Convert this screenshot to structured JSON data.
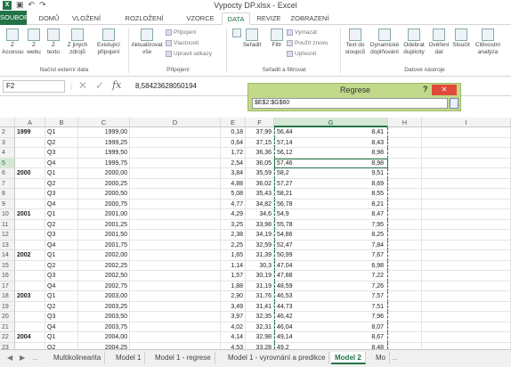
{
  "window": {
    "title": "Vypocty DP.xlsx - Excel",
    "app_icon": "X"
  },
  "ribbon_tabs": [
    {
      "label": "SOUBOR",
      "name": "tab-file"
    },
    {
      "label": "DOMŮ",
      "name": "tab-home"
    },
    {
      "label": "VLOŽENÍ",
      "name": "tab-insert"
    },
    {
      "label": "ROZLOŽENÍ STRÁNKY",
      "name": "tab-page-layout"
    },
    {
      "label": "VZORCE",
      "name": "tab-formulas"
    },
    {
      "label": "DATA",
      "name": "tab-data"
    },
    {
      "label": "REVIZE",
      "name": "tab-review"
    },
    {
      "label": "ZOBRAZENÍ",
      "name": "tab-view"
    }
  ],
  "ribbon": {
    "get_external": {
      "btn_access": "Z\nAccessu",
      "btn_web": "Z\nwebu",
      "btn_text": "Z\ntextu",
      "btn_other": "Z jiných\nzdrojů",
      "btn_existing": "Existující\npřipojení",
      "group_label": "Načíst externí data"
    },
    "connections": {
      "refresh_all": "Aktualizovat\nvše",
      "connections": "Připojení",
      "properties": "Vlastnosti",
      "edit_links": "Upravit odkazy",
      "group_label": "Připojení"
    },
    "sort_filter": {
      "sort": "Seřadit",
      "filter": "Filtr",
      "clear": "Vymazat",
      "reapply": "Použít znovu",
      "advanced": "Upřesnit",
      "group_label": "Seřadit a filtrovat"
    },
    "data_tools": {
      "text_to_columns": "Text do\nsloupců",
      "flash_fill": "Dynamické\ndoplňování",
      "remove_dup": "Odebrat\nduplicity",
      "validation": "Ověření\ndat",
      "consolidate": "Sloučit",
      "what_if": "Citlivostní\nanalýza",
      "group_label": "Datové nástroje"
    }
  },
  "formula_bar": {
    "name_box": "F2",
    "value": "8,58423628050194"
  },
  "dialog": {
    "title": "Regrese",
    "help": "?",
    "close": "✕",
    "input_value": "$E$2:$G$60"
  },
  "columns": [
    "A",
    "B",
    "C",
    "D",
    "E",
    "F",
    "G",
    "H",
    "I"
  ],
  "rows": [
    {
      "num": "2",
      "A": "1999",
      "B": "Q1",
      "C": "1999,00",
      "E": "0,18",
      "F": "37,99",
      "Fb": "56,44",
      "G": "8,41"
    },
    {
      "num": "3",
      "A": "",
      "B": "Q2",
      "C": "1999,25",
      "E": "0,64",
      "F": "37,15",
      "Fb": "57,14",
      "G": "8,43"
    },
    {
      "num": "4",
      "A": "",
      "B": "Q3",
      "C": "1999,50",
      "E": "1,72",
      "F": "36,36",
      "Fb": "56,12",
      "G": "8,98"
    },
    {
      "num": "5",
      "A": "",
      "B": "Q4",
      "C": "1999,75",
      "E": "2,54",
      "F": "36,05",
      "Fb": "57,46",
      "G": "8,98"
    },
    {
      "num": "6",
      "A": "2000",
      "B": "Q1",
      "C": "2000,00",
      "E": "3,84",
      "F": "35,59",
      "Fb": "58,2",
      "G": "9,51"
    },
    {
      "num": "7",
      "A": "",
      "B": "Q2",
      "C": "2000,25",
      "E": "4,88",
      "F": "36,02",
      "Fb": "57,27",
      "G": "8,69"
    },
    {
      "num": "8",
      "A": "",
      "B": "Q3",
      "C": "2000,50",
      "E": "5,08",
      "F": "35,43",
      "Fb": "58,21",
      "G": "8,55"
    },
    {
      "num": "9",
      "A": "",
      "B": "Q4",
      "C": "2000,75",
      "E": "4,77",
      "F": "34,82",
      "Fb": "56,78",
      "G": "8,21"
    },
    {
      "num": "10",
      "A": "2001",
      "B": "Q1",
      "C": "2001,00",
      "E": "4,29",
      "F": "34,6",
      "Fb": "54,9",
      "G": "8,47"
    },
    {
      "num": "11",
      "A": "",
      "B": "Q2",
      "C": "2001,25",
      "E": "3,25",
      "F": "33,98",
      "Fb": "55,78",
      "G": "7,95"
    },
    {
      "num": "12",
      "A": "",
      "B": "Q3",
      "C": "2001,50",
      "E": "2,38",
      "F": "34,19",
      "Fb": "54,86",
      "G": "8,25"
    },
    {
      "num": "13",
      "A": "",
      "B": "Q4",
      "C": "2001,75",
      "E": "2,25",
      "F": "32,59",
      "Fb": "52,47",
      "G": "7,84"
    },
    {
      "num": "14",
      "A": "2002",
      "B": "Q1",
      "C": "2002,00",
      "E": "1,65",
      "F": "31,39",
      "Fb": "50,99",
      "G": "7,67"
    },
    {
      "num": "15",
      "A": "",
      "B": "Q2",
      "C": "2002,25",
      "E": "1,14",
      "F": "30,3",
      "Fb": "47,04",
      "G": "6,98"
    },
    {
      "num": "16",
      "A": "",
      "B": "Q3",
      "C": "2002,50",
      "E": "1,57",
      "F": "30,19",
      "Fb": "47,88",
      "G": "7,22"
    },
    {
      "num": "17",
      "A": "",
      "B": "Q4",
      "C": "2002,75",
      "E": "1,88",
      "F": "31,19",
      "Fb": "48,59",
      "G": "7,26"
    },
    {
      "num": "18",
      "A": "2003",
      "B": "Q1",
      "C": "2003,00",
      "E": "2,90",
      "F": "31,76",
      "Fb": "46,53",
      "G": "7,57"
    },
    {
      "num": "19",
      "A": "",
      "B": "Q2",
      "C": "2003,25",
      "E": "3,49",
      "F": "31,41",
      "Fb": "44,73",
      "G": "7,51"
    },
    {
      "num": "20",
      "A": "",
      "B": "Q3",
      "C": "2003,50",
      "E": "3,97",
      "F": "32,35",
      "Fb": "46,42",
      "G": "7,96"
    },
    {
      "num": "21",
      "A": "",
      "B": "Q4",
      "C": "2003,75",
      "E": "4,02",
      "F": "32,31",
      "Fb": "46,04",
      "G": "8,07"
    },
    {
      "num": "22",
      "A": "2004",
      "B": "Q1",
      "C": "2004,00",
      "E": "4,14",
      "F": "32,98",
      "Fb": "49,14",
      "G": "8,67"
    },
    {
      "num": "23",
      "A": "",
      "B": "Q2",
      "C": "2004,25",
      "E": "4,53",
      "F": "33,28",
      "Fb": "49,2",
      "G": "8,48"
    }
  ],
  "sheet_tabs": {
    "nav_prev": "◀",
    "nav_next": "▶",
    "nav_more": "...",
    "tabs": [
      {
        "label": "Multikolinearita",
        "active": false
      },
      {
        "label": "Model 1",
        "active": false
      },
      {
        "label": "Model 1 - regrese",
        "active": false
      },
      {
        "label": "Model 1 - vyrovnání a predikce",
        "active": false
      },
      {
        "label": "Model 2",
        "active": true
      },
      {
        "label": "Mo",
        "active": false
      }
    ],
    "more": "..."
  },
  "colors": {
    "accent": "#217346",
    "dialog_bg": "#c2d88a",
    "close_red": "#e04a3a"
  }
}
